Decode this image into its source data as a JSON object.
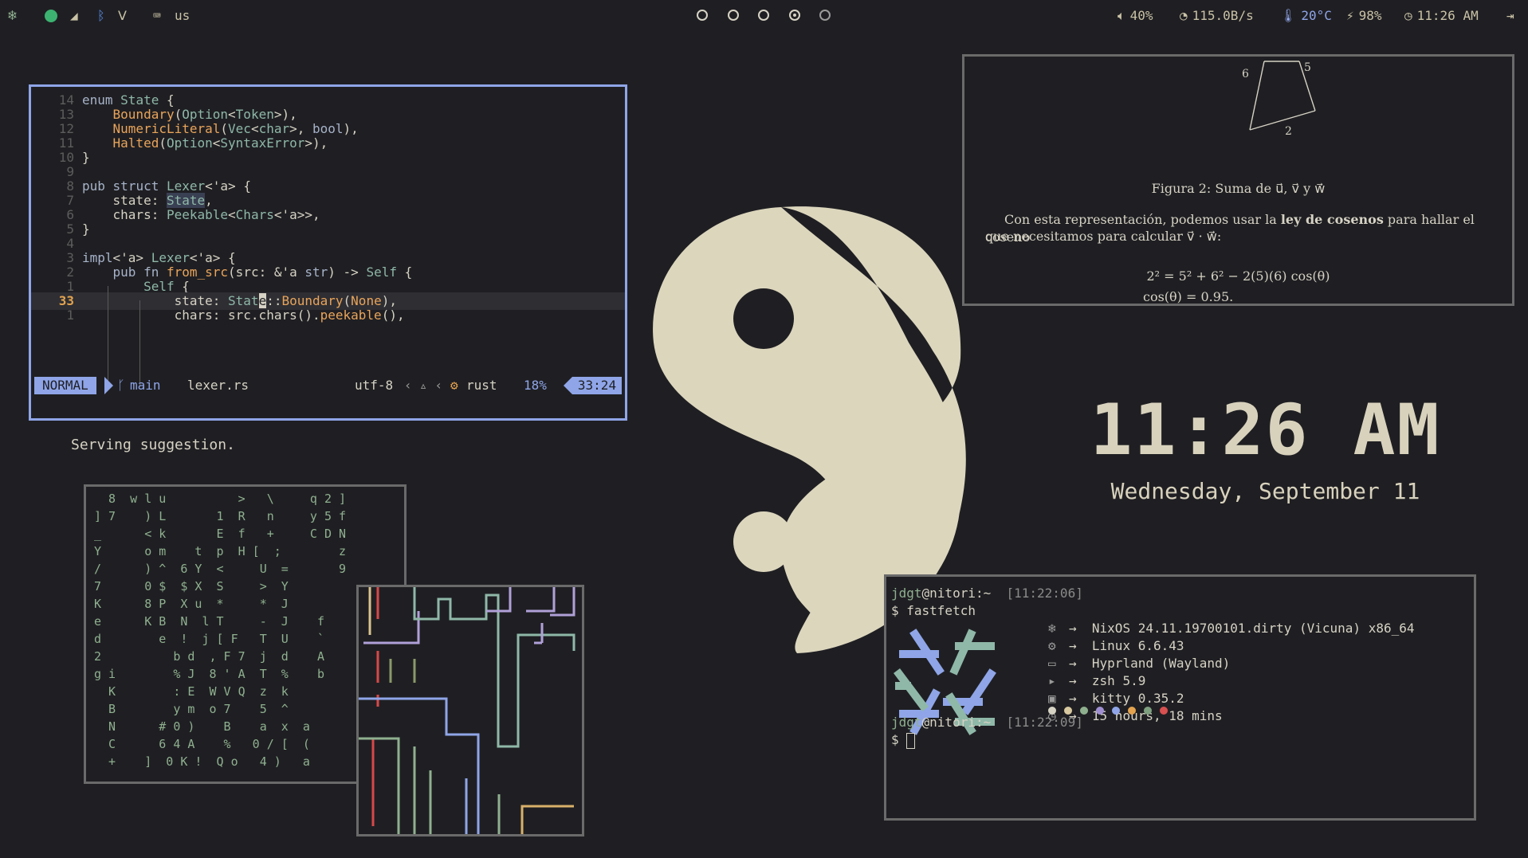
{
  "topbar": {
    "keyboard_layout": "us",
    "workspaces": [
      "1",
      "2",
      "3",
      "4",
      "5"
    ],
    "volume": "40%",
    "network": "115.0B/s",
    "temperature": "20°C",
    "battery": "98%",
    "time": "11:26 AM"
  },
  "editor": {
    "lines": [
      {
        "num": "14",
        "code": "enum State {"
      },
      {
        "num": "13",
        "code": "    Boundary(Option<Token>),"
      },
      {
        "num": "12",
        "code": "    NumericLiteral(Vec<char>, bool),"
      },
      {
        "num": "11",
        "code": "    Halted(Option<SyntaxError>),"
      },
      {
        "num": "10",
        "code": "}"
      },
      {
        "num": "9",
        "code": ""
      },
      {
        "num": "8",
        "code": "pub struct Lexer<'a> {"
      },
      {
        "num": "7",
        "code": "    state: State,"
      },
      {
        "num": "6",
        "code": "    chars: Peekable<Chars<'a>>,"
      },
      {
        "num": "5",
        "code": "}"
      },
      {
        "num": "4",
        "code": ""
      },
      {
        "num": "3",
        "code": "impl<'a> Lexer<'a> {"
      },
      {
        "num": "2",
        "code": "    pub fn from_src(src: &'a str) -> Self {"
      },
      {
        "num": "1",
        "code": "        Self {"
      },
      {
        "num": "33",
        "code": "            state: State::Boundary(None),"
      },
      {
        "num": "1",
        "code": "            chars: src.chars().peekable(),"
      }
    ],
    "status": {
      "mode": "NORMAL",
      "branch": "main",
      "file": "lexer.rs",
      "encoding": "utf-8",
      "filetype": "rust",
      "percent": "18%",
      "position": "33:24"
    },
    "message": "Serving suggestion."
  },
  "matrix_rows": [
    "  8  w l u          >   \\     q 2 ]",
    "] 7    ) L       1  R   n     y 5 f",
    "_      < k       E  f   +     C D N",
    "Y      o m    t  p  H [  ;        z",
    "/      ) ^  6 Y  <     U  =       9",
    "7      0 $  $ X  S     >  Y",
    "K      8 P  X u  *     *  J",
    "e      K B  N  l T     -  J    f",
    "d        e  !  j [ F   T  U    `",
    "2          b d  , F 7  j  d    A",
    "g i        % J  8 ' A  T  %    b",
    "  K        : E  W V Q  z  k",
    "  B        y m  o 7    5  ^",
    "  N      # 0 )    B    a  x  a",
    "  C      6 4 A    %   0 / [  (",
    "  +    ]  0 K !  Q o   4 )   a"
  ],
  "paper": {
    "figure_labels": {
      "a": "6",
      "b": "5",
      "c": "2"
    },
    "caption": "Figura 2: Suma de u⃗, v⃗ y w⃗",
    "paragraph_a": "Con esta representación, podemos usar la ",
    "paragraph_bold": "ley de cosenos",
    "paragraph_b": " para hallar el coseno",
    "paragraph_c": "que necesitamos para calcular v⃗ · w⃗:",
    "eq1": "2² = 5² + 6² − 2(5)(6) cos(θ)",
    "eq2": "cos(θ) = 0.95."
  },
  "clock": {
    "time": "11:26 AM",
    "date": "Wednesday, September 11"
  },
  "terminal": {
    "user": "jdgt",
    "host": "@nitori:~",
    "time1": "[11:22:06]",
    "command": "$ fastfetch",
    "info": [
      {
        "icon": "nix-icon",
        "text": "NixOS 24.11.19700101.dirty (Vicuna) x86_64"
      },
      {
        "icon": "gear-icon",
        "text": "Linux 6.6.43"
      },
      {
        "icon": "window-icon",
        "text": "Hyprland (Wayland)"
      },
      {
        "icon": "shell-icon",
        "text": "zsh 5.9"
      },
      {
        "icon": "terminal-icon",
        "text": "kitty 0.35.2"
      },
      {
        "icon": "clock-icon",
        "text": "15 hours, 18 mins"
      }
    ],
    "palette": [
      "#d6d2c4",
      "#d8c9a0",
      "#8fb08f",
      "#9f8fd0",
      "#8fa5e8",
      "#e3a34f",
      "#7fa07f",
      "#d85050"
    ],
    "time2": "[11:22:09]",
    "prompt2": "$ "
  },
  "colors": {
    "accent": "#8fa5e8",
    "background": "#1f1f23",
    "foreground": "#d6d2c4"
  }
}
